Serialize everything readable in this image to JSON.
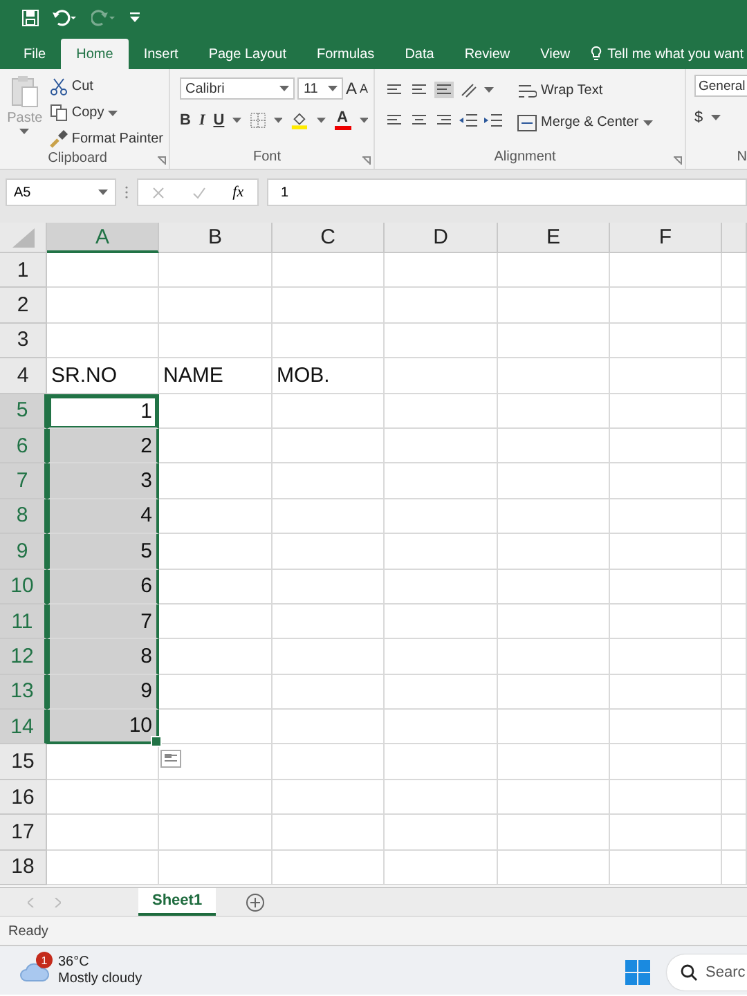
{
  "tabs": [
    {
      "label": "File",
      "selected": false
    },
    {
      "label": "Home",
      "selected": true
    },
    {
      "label": "Insert",
      "selected": false
    },
    {
      "label": "Page Layout",
      "selected": false
    },
    {
      "label": "Formulas",
      "selected": false
    },
    {
      "label": "Data",
      "selected": false
    },
    {
      "label": "Review",
      "selected": false
    },
    {
      "label": "View",
      "selected": false
    }
  ],
  "tell_me": "Tell me what you want",
  "clipboard": {
    "paste": "Paste",
    "cut": "Cut",
    "copy": "Copy",
    "format_painter": "Format Painter",
    "label": "Clipboard"
  },
  "font": {
    "name": "Calibri",
    "size": "11",
    "grow": "A",
    "shrink": "A",
    "bold": "B",
    "italic": "I",
    "underline": "U",
    "font_color": "A",
    "label": "Font"
  },
  "alignment": {
    "wrap_text": "Wrap Text",
    "merge_center": "Merge & Center",
    "label": "Alignment"
  },
  "number": {
    "format": "General",
    "currency": "$",
    "label": "N"
  },
  "formula_bar": {
    "name_box": "A5",
    "function_label": "fx",
    "formula": "1"
  },
  "columns": [
    {
      "label": "A",
      "selected": true
    },
    {
      "label": "B",
      "selected": false
    },
    {
      "label": "C",
      "selected": false
    },
    {
      "label": "D",
      "selected": false
    },
    {
      "label": "E",
      "selected": false
    },
    {
      "label": "F",
      "selected": false
    }
  ],
  "rows": [
    {
      "number": "1",
      "cells": []
    },
    {
      "number": "2",
      "cells": []
    },
    {
      "number": "3",
      "cells": []
    },
    {
      "number": "4",
      "cells": [
        {
          "text": "SR.NO",
          "kind": "text",
          "selected": false
        },
        {
          "text": "NAME",
          "kind": "text",
          "selected": false
        },
        {
          "text": "MOB.",
          "kind": "text",
          "selected": false
        }
      ]
    },
    {
      "number": "5",
      "cells": [
        {
          "text": "1",
          "kind": "number",
          "selected": true,
          "active": true
        }
      ]
    },
    {
      "number": "6",
      "cells": [
        {
          "text": "2",
          "kind": "number",
          "selected": true,
          "active": false
        }
      ]
    },
    {
      "number": "7",
      "cells": [
        {
          "text": "3",
          "kind": "number",
          "selected": true,
          "active": false
        }
      ]
    },
    {
      "number": "8",
      "cells": [
        {
          "text": "4",
          "kind": "number",
          "selected": true,
          "active": false
        }
      ]
    },
    {
      "number": "9",
      "cells": [
        {
          "text": "5",
          "kind": "number",
          "selected": true,
          "active": false
        }
      ]
    },
    {
      "number": "10",
      "cells": [
        {
          "text": "6",
          "kind": "number",
          "selected": true,
          "active": false
        }
      ]
    },
    {
      "number": "11",
      "cells": [
        {
          "text": "7",
          "kind": "number",
          "selected": true,
          "active": false
        }
      ]
    },
    {
      "number": "12",
      "cells": [
        {
          "text": "8",
          "kind": "number",
          "selected": true,
          "active": false
        }
      ]
    },
    {
      "number": "13",
      "cells": [
        {
          "text": "9",
          "kind": "number",
          "selected": true,
          "active": false
        }
      ]
    },
    {
      "number": "14",
      "cells": [
        {
          "text": "10",
          "kind": "number",
          "selected": true,
          "active": false
        }
      ]
    },
    {
      "number": "15",
      "cells": []
    },
    {
      "number": "16",
      "cells": []
    },
    {
      "number": "17",
      "cells": []
    },
    {
      "number": "18",
      "cells": []
    }
  ],
  "sheet_tabs": [
    {
      "label": "Sheet1",
      "selected": true
    }
  ],
  "status": "Ready",
  "taskbar": {
    "badge": "1",
    "temperature": "36°C",
    "condition": "Mostly cloudy",
    "search": "Searc"
  }
}
